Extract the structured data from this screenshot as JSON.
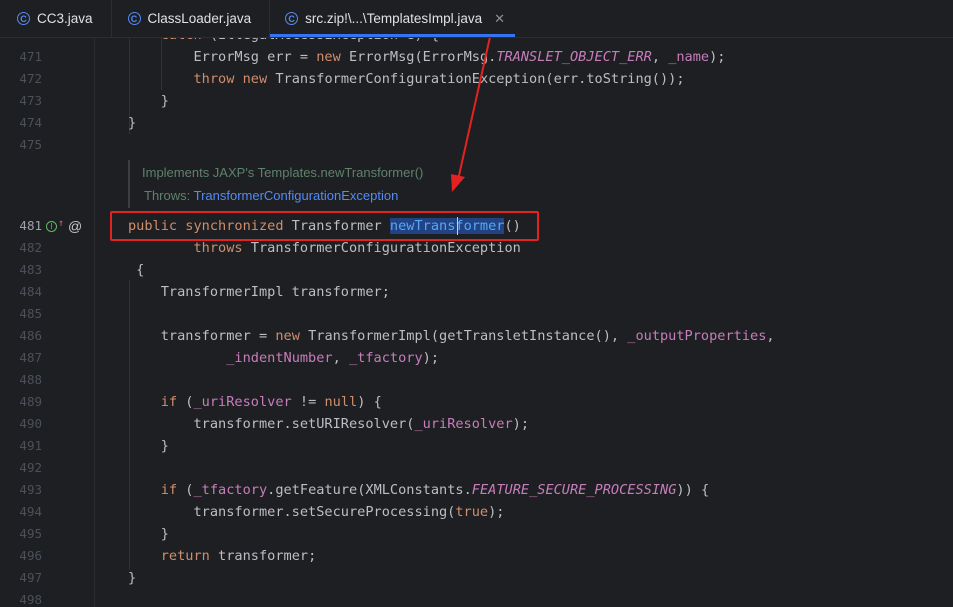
{
  "tabs": [
    {
      "label": "CC3.java",
      "icon": "class-icon",
      "active": false
    },
    {
      "label": "ClassLoader.java",
      "icon": "class-icon",
      "active": false
    },
    {
      "label": "src.zip!\\...\\TemplatesImpl.java",
      "icon": "class-icon",
      "active": true,
      "close": "✕"
    }
  ],
  "doc": {
    "implements": "Implements JAXP's Templates.newTransformer()",
    "throws_label": "Throws: ",
    "throws_link": "TransformerConfigurationException"
  },
  "gutter": {
    "impl_badge": "I",
    "at": "@"
  },
  "lines": [
    {
      "n": "471",
      "tokens": [
        [
          "",
          "        ErrorMsg err = "
        ],
        [
          "kw",
          "new"
        ],
        [
          "",
          " ErrorMsg(ErrorMsg."
        ],
        [
          "ifld",
          "TRANSLET_OBJECT_ERR"
        ],
        [
          "",
          ", "
        ],
        [
          "fld",
          "_name"
        ],
        [
          "",
          ");"
        ]
      ]
    },
    {
      "n": "472",
      "tokens": [
        [
          "",
          "        "
        ],
        [
          "kw",
          "throw new"
        ],
        [
          "",
          " TransformerConfigurationException(err.toString());"
        ]
      ]
    },
    {
      "n": "473",
      "tokens": [
        [
          "",
          "    }"
        ]
      ]
    },
    {
      "n": "474",
      "tokens": [
        [
          "",
          "}"
        ]
      ]
    },
    {
      "n": "475",
      "tokens": []
    },
    {
      "n": "481",
      "current": true,
      "tokens": [
        [
          "kw",
          "public synchronized"
        ],
        [
          "",
          " Transformer "
        ],
        [
          "mth hl",
          "newTransformer"
        ],
        [
          "",
          "()"
        ]
      ]
    },
    {
      "n": "482",
      "tokens": [
        [
          "",
          "        "
        ],
        [
          "kw",
          "throws"
        ],
        [
          "",
          " TransformerConfigurationException"
        ]
      ]
    },
    {
      "n": "483",
      "tokens": [
        [
          "",
          " {"
        ]
      ]
    },
    {
      "n": "484",
      "tokens": [
        [
          "",
          "    TransformerImpl transformer;"
        ]
      ]
    },
    {
      "n": "485",
      "tokens": []
    },
    {
      "n": "486",
      "tokens": [
        [
          "",
          "    transformer = "
        ],
        [
          "kw",
          "new"
        ],
        [
          "",
          " TransformerImpl(getTransletInstance(), "
        ],
        [
          "fld",
          "_outputProperties"
        ],
        [
          "",
          ","
        ]
      ]
    },
    {
      "n": "487",
      "tokens": [
        [
          "",
          "            "
        ],
        [
          "fld",
          "_indentNumber"
        ],
        [
          "",
          ", "
        ],
        [
          "fld",
          "_tfactory"
        ],
        [
          "",
          ");"
        ]
      ]
    },
    {
      "n": "488",
      "tokens": []
    },
    {
      "n": "489",
      "tokens": [
        [
          "",
          "    "
        ],
        [
          "kw",
          "if"
        ],
        [
          "",
          " ("
        ],
        [
          "fld",
          "_uriResolver"
        ],
        [
          "",
          " != "
        ],
        [
          "kw",
          "null"
        ],
        [
          "",
          ") {"
        ]
      ]
    },
    {
      "n": "490",
      "tokens": [
        [
          "",
          "        transformer.setURIResolver("
        ],
        [
          "fld",
          "_uriResolver"
        ],
        [
          "",
          ");"
        ]
      ]
    },
    {
      "n": "491",
      "tokens": [
        [
          "",
          "    }"
        ]
      ]
    },
    {
      "n": "492",
      "tokens": []
    },
    {
      "n": "493",
      "tokens": [
        [
          "",
          "    "
        ],
        [
          "kw",
          "if"
        ],
        [
          "",
          " ("
        ],
        [
          "fld",
          "_tfactory"
        ],
        [
          "",
          ".getFeature(XMLConstants."
        ],
        [
          "ifld",
          "FEATURE_SECURE_PROCESSING"
        ],
        [
          "",
          ")) {"
        ]
      ]
    },
    {
      "n": "494",
      "tokens": [
        [
          "",
          "        transformer.setSecureProcessing("
        ],
        [
          "kw",
          "true"
        ],
        [
          "",
          ");"
        ]
      ]
    },
    {
      "n": "495",
      "tokens": [
        [
          "",
          "    }"
        ]
      ]
    },
    {
      "n": "496",
      "tokens": [
        [
          "",
          "    "
        ],
        [
          "kw",
          "return"
        ],
        [
          "",
          " transformer;"
        ]
      ]
    },
    {
      "n": "497",
      "tokens": [
        [
          "",
          "}"
        ]
      ]
    },
    {
      "n": "498",
      "tokens": []
    }
  ],
  "colors": {
    "background": "#1e1f22",
    "keyword": "#cf8e6d",
    "field": "#c77dbb",
    "method": "#56a8f5",
    "annotation_box": "#e52222"
  }
}
